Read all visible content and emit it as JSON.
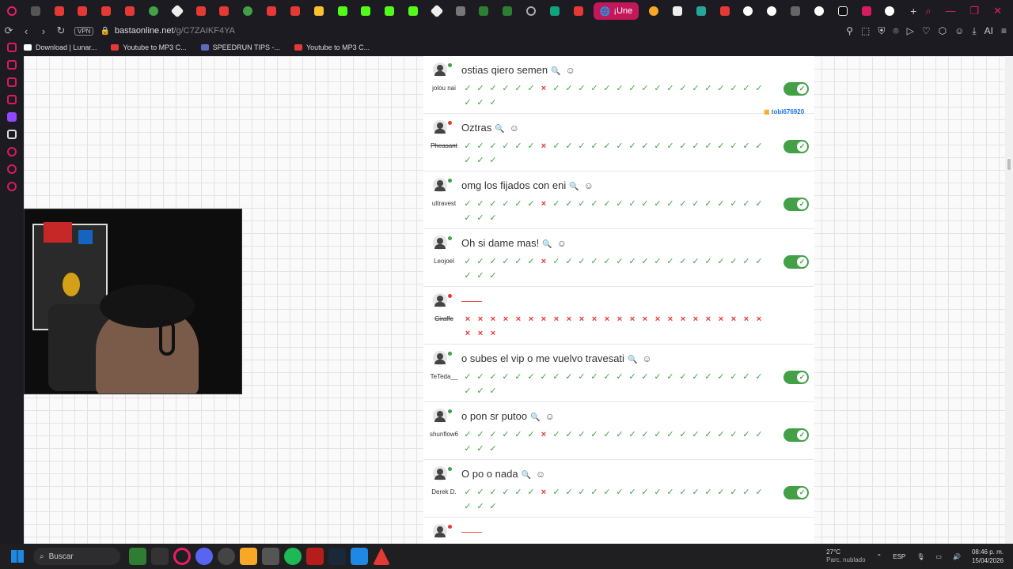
{
  "browser": {
    "tabs_active_label": "¡Une",
    "url_domain": "bastaonline.net",
    "url_path": "/g/C7ZAIKF4YA",
    "vpn_label": "VPN",
    "ai_label": "AI"
  },
  "bookmarks": [
    {
      "label": "Download | Lunar...",
      "color": "#ffffff"
    },
    {
      "label": "Youtube to MP3 C...",
      "color": "#e53935"
    },
    {
      "label": "SPEEDRUN TIPS -...",
      "color": "#5c6bc0"
    },
    {
      "label": "Youtube to MP3 C...",
      "color": "#e53935"
    }
  ],
  "overlay_tag": "tobi676920",
  "answers": [
    {
      "user": "jolou nai",
      "answer": "ostias qiero semen",
      "status": "#43a047",
      "strike": false,
      "empty": false,
      "no_index": 6,
      "toggle": true
    },
    {
      "user": "Pheasant",
      "answer": "Oztras",
      "status": "#e53935",
      "strike": true,
      "empty": false,
      "no_index": 6,
      "toggle": true
    },
    {
      "user": "ultravest",
      "answer": "omg los fijados con eni",
      "status": "#43a047",
      "strike": false,
      "empty": false,
      "no_index": 6,
      "toggle": true
    },
    {
      "user": "Leojoel",
      "answer": "Oh si dame mas!",
      "status": "#43a047",
      "strike": false,
      "empty": false,
      "no_index": 6,
      "toggle": true
    },
    {
      "user": "Giraffe",
      "answer": "——",
      "status": "#e53935",
      "strike": true,
      "empty": true,
      "no_index": -1,
      "toggle": false
    },
    {
      "user": "TeTeda__",
      "answer": "o subes el vip o me vuelvo travesati",
      "status": "#43a047",
      "strike": false,
      "empty": false,
      "no_index": -2,
      "toggle": true
    },
    {
      "user": "shunflow6",
      "answer": "o pon sr putoo",
      "status": "#43a047",
      "strike": false,
      "empty": false,
      "no_index": 6,
      "toggle": true
    },
    {
      "user": "Derek D.",
      "answer": "O po o nada",
      "status": "#43a047",
      "strike": false,
      "empty": false,
      "no_index": 6,
      "toggle": true
    },
    {
      "user": "",
      "answer": "——",
      "status": "#e53935",
      "strike": false,
      "empty": true,
      "no_index": -1,
      "toggle": false
    }
  ],
  "vote_count": 27,
  "icons": {
    "search": "search-icon",
    "react": "smiley-icon",
    "vote_ok": "check-icon",
    "vote_no": "cross-icon"
  },
  "taskbar": {
    "search_label": "Buscar",
    "temp": "27°C",
    "weather_text": "Parc. nublado",
    "lang": "ESP",
    "time": "08:46 p. m.",
    "date": "15/04/2026"
  }
}
